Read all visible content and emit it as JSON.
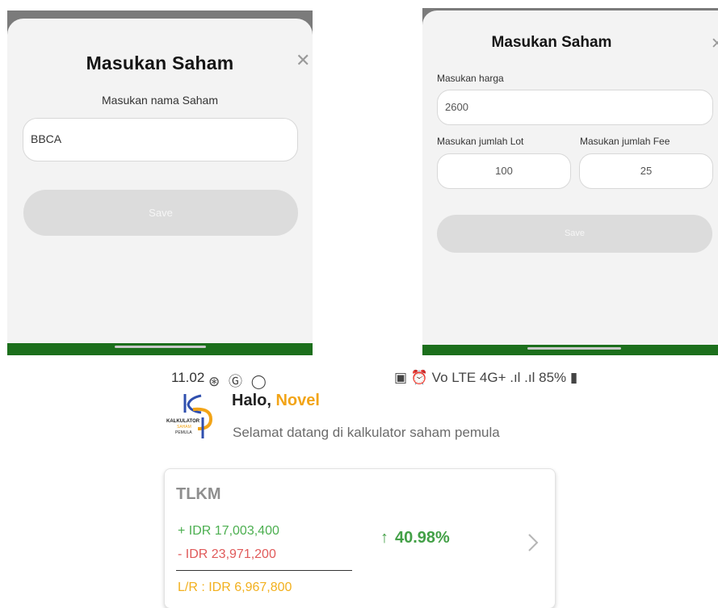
{
  "modal_name": {
    "title": "Masukan Saham",
    "close_icon": "close-icon",
    "label": "Masukan nama Saham",
    "value": "BBCA",
    "save_label": "Save"
  },
  "modal_price": {
    "title": "Masukan Saham",
    "close_icon": "close-icon",
    "price_label": "Masukan harga",
    "price_value": "2600",
    "lot_label": "Masukan jumlah Lot",
    "lot_value": "100",
    "fee_label": "Masukan jumlah Fee",
    "fee_value": "25",
    "save_label": "Save"
  },
  "status_bar": {
    "time": "11.02",
    "left_icons": "⊛ Ⓖ ◯",
    "right_text": "▣ ⏰ Vo LTE 4G+ .ıl .ıl 85% ▮"
  },
  "home": {
    "logo_text_1": "KALKULATOR",
    "logo_text_2": "SAHAM",
    "logo_text_3": "PEMULA",
    "greeting": "Halo, ",
    "user_name": "Novel",
    "welcome": "Selamat datang di kalkulator saham pemula"
  },
  "portfolio_card": {
    "ticker": "TLKM",
    "plus": "+ IDR 17,003,400",
    "minus": "- IDR 23,971,200",
    "lr": "L/R : IDR 6,967,800",
    "percent": "40.98%",
    "arrow_icon": "arrow-up-icon",
    "chevron_icon": "chevron-right-icon"
  },
  "colors": {
    "accent_green": "#1c6f1c",
    "profit_green": "#43a047",
    "loss_red": "#e05a5a",
    "highlight_orange": "#f2a417"
  }
}
